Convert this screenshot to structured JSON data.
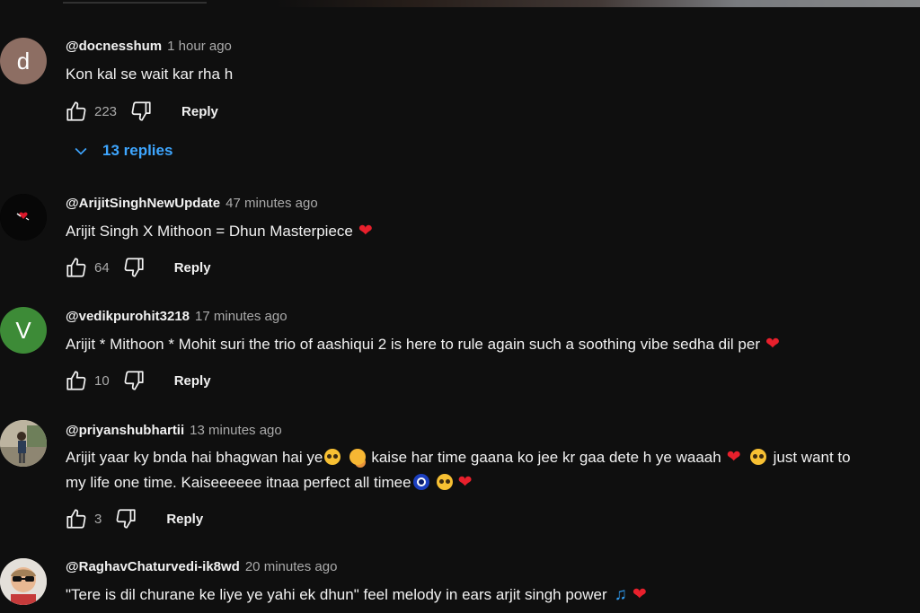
{
  "colors": {
    "background": "#0f0f0f",
    "text": "#f1f1f1",
    "muted": "#aaaaaa",
    "link_blue": "#3ea6ff",
    "heart_red": "#e8202c"
  },
  "labels": {
    "reply": "Reply"
  },
  "comments": [
    {
      "avatar_letter": "d",
      "avatar_color": "#8d6e63",
      "author": "@docnesshum",
      "time": "1 hour ago",
      "text": "Kon kal se wait kar rha h",
      "likes": "223",
      "replies_label": "13 replies"
    },
    {
      "avatar_letter": "",
      "avatar_color": "#000000",
      "avatar_icon": "heart-bird-icon",
      "author": "@ArijitSinghNewUpdate",
      "time": "47 minutes ago",
      "text": "Arijit Singh X Mithoon = Dhun Masterpiece",
      "emoji_after": [
        "red-heart"
      ],
      "likes": "64"
    },
    {
      "avatar_letter": "V",
      "avatar_color": "#3d8b37",
      "author": "@vedikpurohit3218",
      "time": "17 minutes ago",
      "text": "Arijit * Mithoon * Mohit suri the trio of aashiqui 2 is here to rule again such a soothing vibe sedha dil per",
      "emoji_after": [
        "red-heart"
      ],
      "likes": "10"
    },
    {
      "avatar_icon": "photo-person-icon",
      "avatar_color": "#c9c2b3",
      "author": "@priyanshubhartii",
      "time": "13 minutes ago",
      "text_line1_a": "Arijit yaar ky bnda hai bhagwan hai ye",
      "text_line1_b": "kaise har time gaana ko jee kr gaa dete h ye waaah",
      "text_line1_c": "just want to",
      "text_line2": "my life one time. Kaiseeeeee itnaa perfect all timee",
      "emoji_line1": [
        "pleading-face",
        "hugging-face",
        "red-heart",
        "pleading-face"
      ],
      "emoji_line2": [
        "nazar-amulet",
        "pleading-face",
        "red-heart"
      ],
      "likes": "3"
    },
    {
      "avatar_icon": "photo-sunglasses-icon",
      "avatar_color": "#d9d4cc",
      "author": "@RaghavChaturvedi-ik8wd",
      "time": "20 minutes ago",
      "text": "\"Tere is dil churane ke liye ye yahi ek dhun\" feel melody in ears arjit singh power",
      "emoji_after": [
        "musical-notes",
        "red-heart"
      ]
    }
  ]
}
